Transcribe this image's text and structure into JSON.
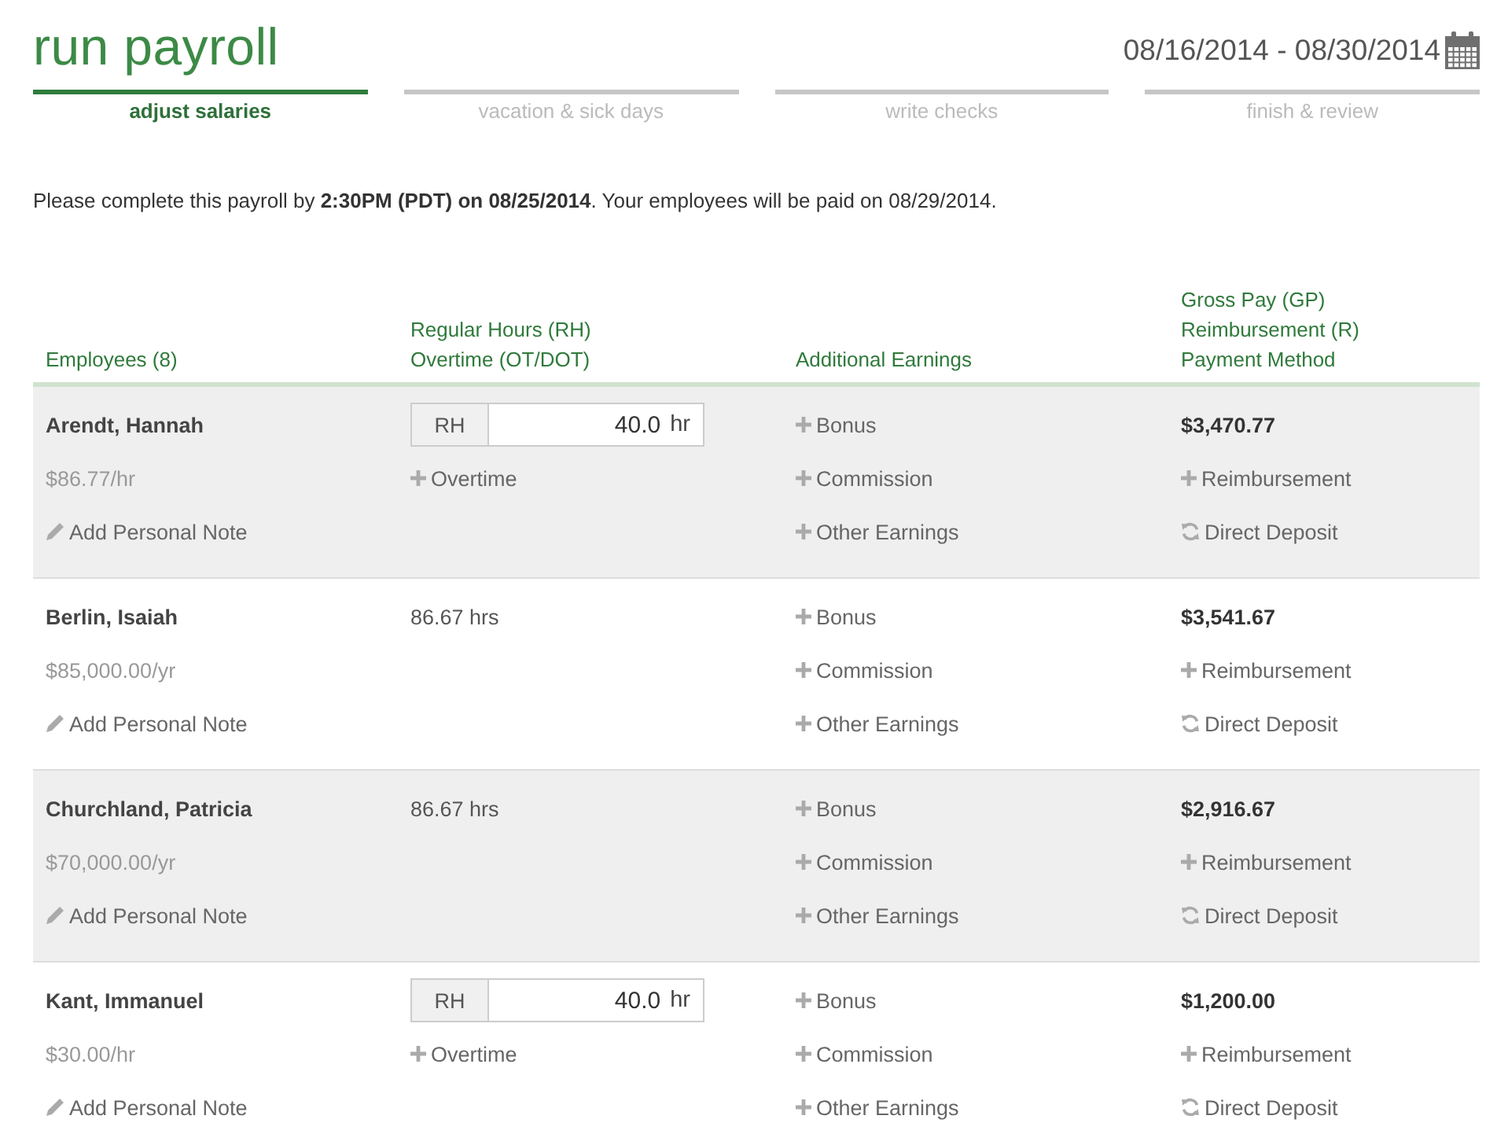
{
  "page": {
    "title": "run payroll",
    "date_range": "08/16/2014 - 08/30/2014"
  },
  "steps": [
    {
      "label": "adjust salaries",
      "selected": true
    },
    {
      "label": "vacation & sick days",
      "selected": false
    },
    {
      "label": "write checks",
      "selected": false
    },
    {
      "label": "finish & review",
      "selected": false
    }
  ],
  "notice": "Please complete this payroll by **2:30PM (PDT) on 08/25/2014**. Your employees will be paid on 08/29/2014.",
  "table": {
    "columns": [
      {
        "lines": [
          "Employees (8)"
        ]
      },
      {
        "lines": [
          "Regular Hours (RH)",
          "Overtime (OT/DOT)"
        ]
      },
      {
        "lines": [
          "Additional Earnings"
        ]
      },
      {
        "lines": [
          "Gross Pay (GP)",
          "Reimbursement (R)",
          "Payment Method"
        ]
      }
    ],
    "rows": [
      {
        "name": "Arendt, Hannah",
        "rate": "$86.77/hr",
        "note_link": "Add Personal Note",
        "hours": {
          "kind": "input",
          "prefix": "RH",
          "value": "40.0",
          "unit": "hr",
          "overtime_link": "Overtime"
        },
        "earnings": [
          "Bonus",
          "Commission",
          "Other Earnings"
        ],
        "gross_pay": "$3,470.77",
        "reimbursement_link": "Reimbursement",
        "payment_method": "Direct Deposit"
      },
      {
        "name": "Berlin, Isaiah",
        "rate": "$85,000.00/yr",
        "note_link": "Add Personal Note",
        "hours": {
          "kind": "text",
          "text": "86.67 hrs"
        },
        "earnings": [
          "Bonus",
          "Commission",
          "Other Earnings"
        ],
        "gross_pay": "$3,541.67",
        "reimbursement_link": "Reimbursement",
        "payment_method": "Direct Deposit"
      },
      {
        "name": "Churchland, Patricia",
        "rate": "$70,000.00/yr",
        "note_link": "Add Personal Note",
        "hours": {
          "kind": "text",
          "text": "86.67 hrs"
        },
        "earnings": [
          "Bonus",
          "Commission",
          "Other Earnings"
        ],
        "gross_pay": "$2,916.67",
        "reimbursement_link": "Reimbursement",
        "payment_method": "Direct Deposit"
      },
      {
        "name": "Kant, Immanuel",
        "rate": "$30.00/hr",
        "note_link": "Add Personal Note",
        "hours": {
          "kind": "input",
          "prefix": "RH",
          "value": "40.0",
          "unit": "hr",
          "overtime_link": "Overtime"
        },
        "earnings": [
          "Bonus",
          "Commission",
          "Other Earnings"
        ],
        "gross_pay": "$1,200.00",
        "reimbursement_link": "Reimbursement",
        "payment_method": "Direct Deposit"
      }
    ]
  }
}
